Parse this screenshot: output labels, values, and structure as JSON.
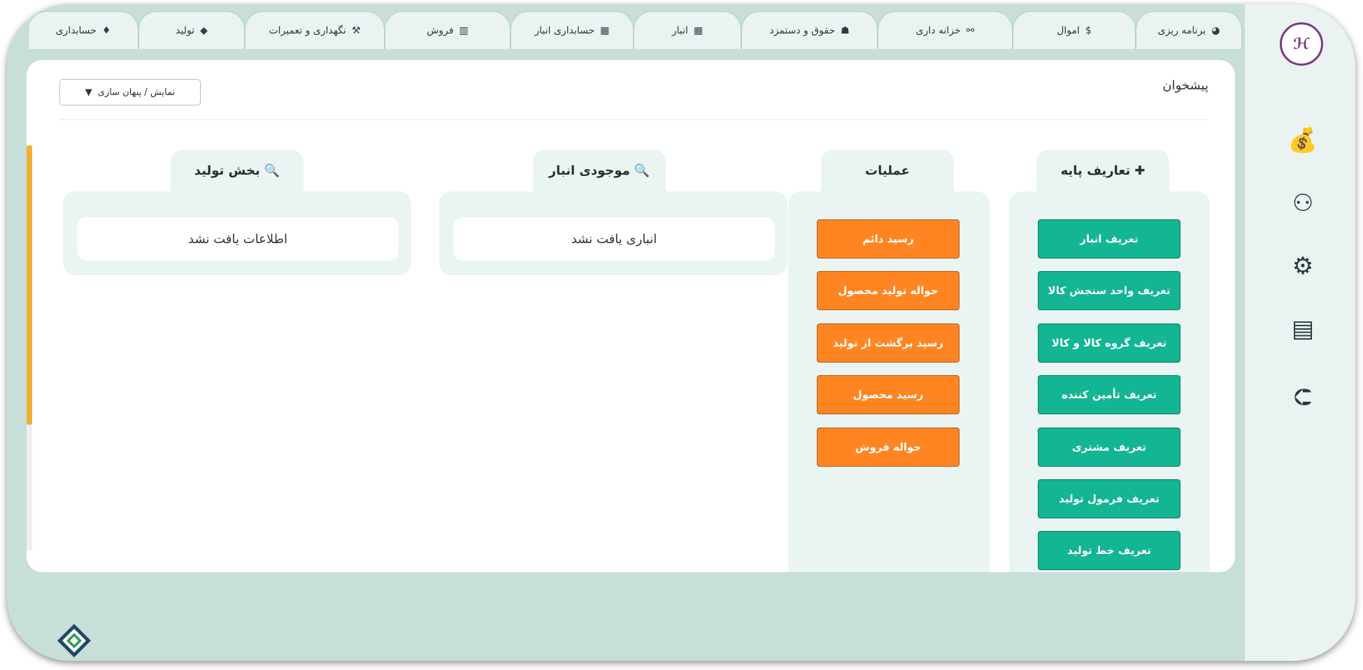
{
  "tabs": [
    {
      "label": "برنامه ریزی",
      "icon": "pie-chart-icon",
      "glyph": "◕"
    },
    {
      "label": "اموال",
      "icon": "dollar-doc-icon",
      "glyph": "$"
    },
    {
      "label": "خزانه داری",
      "icon": "link-icon",
      "glyph": "⚯"
    },
    {
      "label": "حقوق و دستمزد",
      "icon": "people-icon",
      "glyph": "☗"
    },
    {
      "label": "انبار",
      "icon": "warehouse-icon",
      "glyph": "▦"
    },
    {
      "label": "حسابداری انبار",
      "icon": "warehouse-accounting-icon",
      "glyph": "▦"
    },
    {
      "label": "فروش",
      "icon": "bar-chart-icon",
      "glyph": "▥"
    },
    {
      "label": "نگهداری و تعمیرات",
      "icon": "tools-icon",
      "glyph": "⚒"
    },
    {
      "label": "تولید",
      "icon": "tag-icon",
      "glyph": "◆"
    },
    {
      "label": "حسابداری",
      "icon": "diamond-icon",
      "glyph": "♦"
    }
  ],
  "logo_text": "ℋ",
  "sidebar_icons": [
    {
      "name": "money-bag-icon",
      "glyph": "💰"
    },
    {
      "name": "users-network-icon",
      "glyph": "⚇"
    },
    {
      "name": "gear-icon",
      "glyph": "⚙"
    },
    {
      "name": "messages-icon",
      "glyph": "▤"
    },
    {
      "name": "logout-icon",
      "glyph": "⮈"
    }
  ],
  "page": {
    "title": "پیشخوان",
    "toggle_label": "نمایش / پنهان سازی",
    "toggle_arrow": "▼"
  },
  "panels": {
    "base": {
      "title": "تعاریف پایه",
      "icon_glyph": "✚",
      "buttons": [
        "تعریف انبار",
        "تعریف واحد سنجش کالا",
        "تعریف گروه کالا و کالا",
        "تعریف تأمین کننده",
        "تعریف مشتری",
        "تعریف فرمول تولید",
        "تعریف خط تولید"
      ]
    },
    "operations": {
      "title": "عملیات",
      "buttons": [
        "رسید دائم",
        "حواله تولید محصول",
        "رسید برگشت از تولید",
        "رسید محصول",
        "حواله فروش"
      ]
    },
    "inventory": {
      "title": "موجودی انبار",
      "icon_glyph": "🔍",
      "empty_text": "انباری یافت نشد"
    },
    "production": {
      "title": "بخش تولید",
      "icon_glyph": "🔍",
      "empty_text": "اطلاعات یافت نشد"
    }
  },
  "colors": {
    "frame": "#c7ded9",
    "panel": "#e9f4f3",
    "orange": "#ff8522",
    "teal": "#13b592",
    "scroll": "#f0b030"
  }
}
